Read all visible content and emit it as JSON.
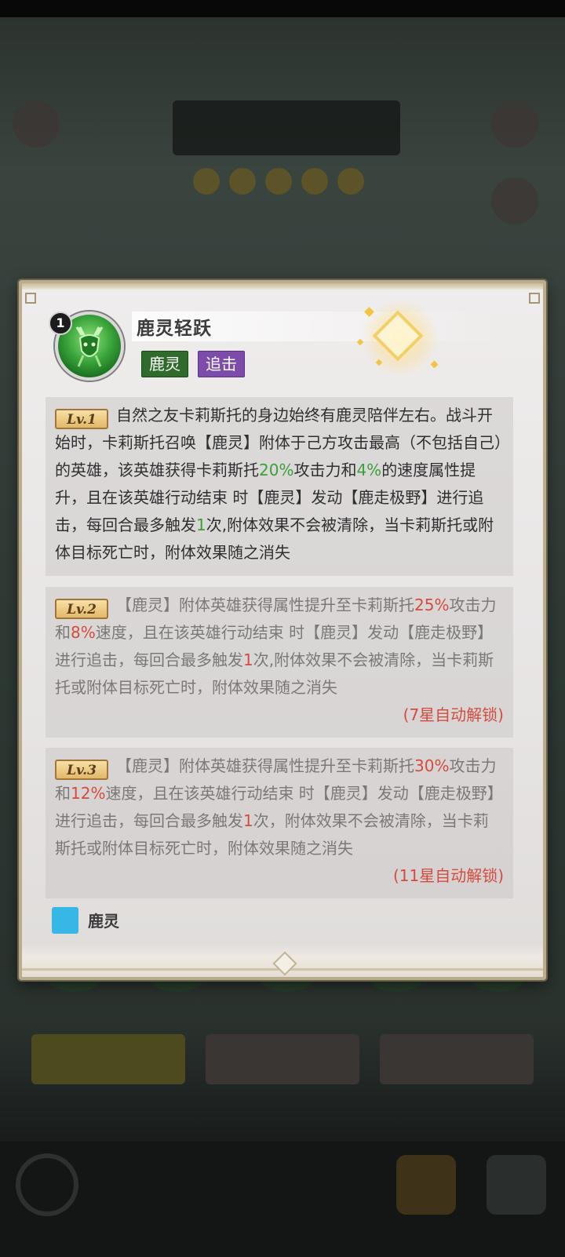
{
  "skill": {
    "order": "1",
    "name": "鹿灵轻跃",
    "tags": [
      "鹿灵",
      "追击"
    ],
    "icon": "deer-spirit-icon"
  },
  "levels": [
    {
      "badge": "Lv.1",
      "segments": [
        {
          "t": "自然之友卡莉斯托的身边始终有鹿灵陪伴左右。战斗开始时，卡莉斯托召唤【鹿灵】附体于己方攻击最高（不包括自己）的英雄，该英雄获得卡莉斯托",
          "c": ""
        },
        {
          "t": "20%",
          "c": "g"
        },
        {
          "t": "攻击力和",
          "c": ""
        },
        {
          "t": "4%",
          "c": "g"
        },
        {
          "t": "的速度属性提升，且在该英雄行动结束 时【鹿灵】发动【鹿走极野】进行追击，每回合最多触发",
          "c": ""
        },
        {
          "t": "1",
          "c": "g"
        },
        {
          "t": "次,附体效果不会被清除，当卡莉斯托或附体目标死亡时，附体效果随之消失",
          "c": ""
        }
      ],
      "unlock": ""
    },
    {
      "badge": "Lv.2",
      "segments": [
        {
          "t": "【鹿灵】附体英雄获得属性提升至卡莉斯托",
          "c": ""
        },
        {
          "t": "25%",
          "c": "r"
        },
        {
          "t": "攻击力和",
          "c": ""
        },
        {
          "t": "8%",
          "c": "r"
        },
        {
          "t": "速度，且在该英雄行动结束 时【鹿灵】发动【鹿走极野】进行追击，每回合最多触发",
          "c": ""
        },
        {
          "t": "1",
          "c": "r"
        },
        {
          "t": "次,附体效果不会被清除，当卡莉斯托或附体目标死亡时，附体效果随之消失",
          "c": ""
        }
      ],
      "unlock": "(7星自动解锁)"
    },
    {
      "badge": "Lv.3",
      "segments": [
        {
          "t": "【鹿灵】附体英雄获得属性提升至卡莉斯托",
          "c": ""
        },
        {
          "t": "30%",
          "c": "r"
        },
        {
          "t": "攻击力和",
          "c": ""
        },
        {
          "t": "12%",
          "c": "r"
        },
        {
          "t": "速度，且在该英雄行动结束 时【鹿灵】发动【鹿走极野】进行追击，每回合最多触发",
          "c": ""
        },
        {
          "t": "1",
          "c": "r"
        },
        {
          "t": "次，附体效果不会被清除，当卡莉斯托或附体目标死亡时，附体效果随之消失",
          "c": ""
        }
      ],
      "unlock": "(11星自动解锁)"
    }
  ],
  "next_section": {
    "label": "鹿灵",
    "icon": "buff-icon"
  },
  "colors": {
    "highlight_green": "#3aa13a",
    "highlight_red": "#d34c3e",
    "tag_green": "#2f6b2b",
    "tag_purple": "#7d4cab"
  }
}
